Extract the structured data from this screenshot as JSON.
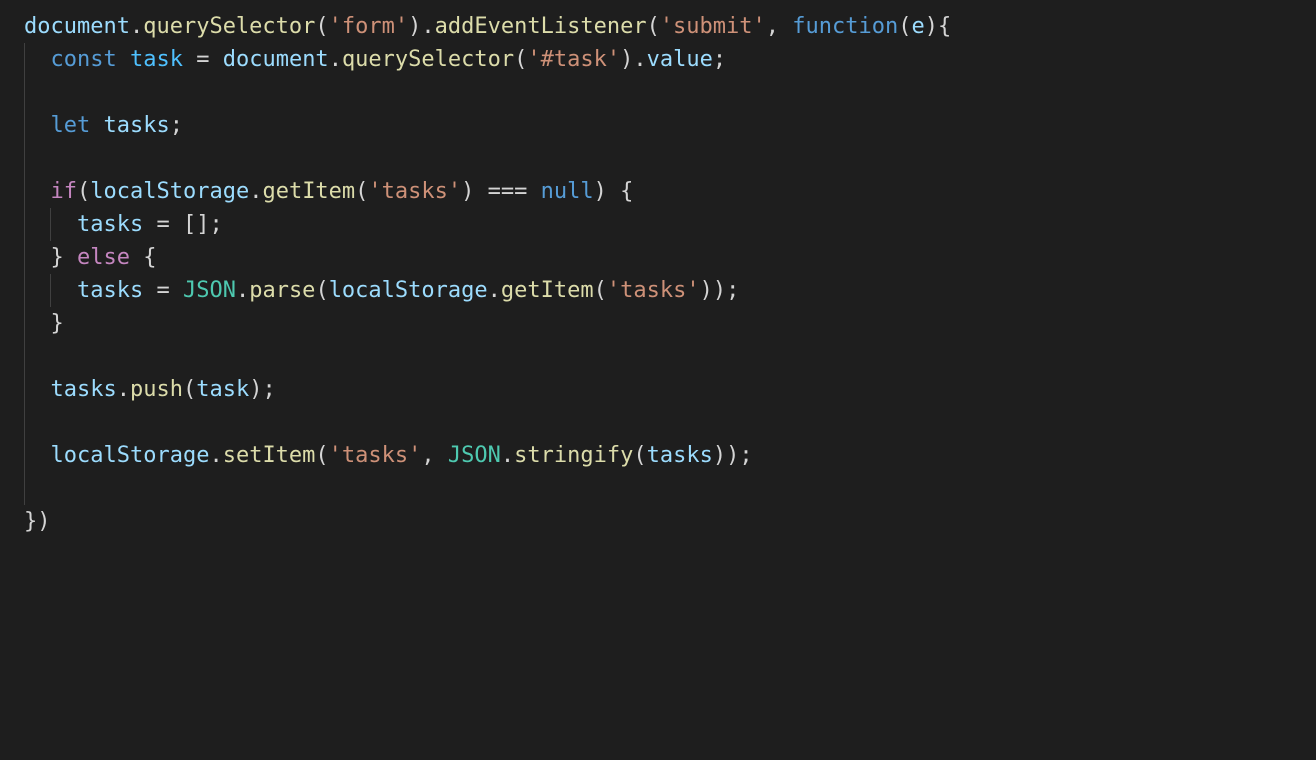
{
  "code": {
    "lines": [
      {
        "indent": 0,
        "tokens": [
          [
            "obj",
            "document"
          ],
          [
            "punc",
            "."
          ],
          [
            "meth",
            "querySelector"
          ],
          [
            "punc",
            "("
          ],
          [
            "str",
            "'form'"
          ],
          [
            "punc",
            ")."
          ],
          [
            "meth",
            "addEventListener"
          ],
          [
            "punc",
            "("
          ],
          [
            "str",
            "'submit'"
          ],
          [
            "punc",
            ", "
          ],
          [
            "kw",
            "function"
          ],
          [
            "punc",
            "("
          ],
          [
            "obj",
            "e"
          ],
          [
            "punc",
            "){"
          ]
        ]
      },
      {
        "indent": 1,
        "tokens": [
          [
            "kw",
            "const"
          ],
          [
            "punc",
            " "
          ],
          [
            "const",
            "task"
          ],
          [
            "punc",
            " = "
          ],
          [
            "obj",
            "document"
          ],
          [
            "punc",
            "."
          ],
          [
            "meth",
            "querySelector"
          ],
          [
            "punc",
            "("
          ],
          [
            "str",
            "'#task'"
          ],
          [
            "punc",
            ")."
          ],
          [
            "obj",
            "value"
          ],
          [
            "punc",
            ";"
          ]
        ]
      },
      {
        "indent": 1,
        "tokens": []
      },
      {
        "indent": 1,
        "tokens": [
          [
            "kw",
            "let"
          ],
          [
            "punc",
            " "
          ],
          [
            "obj",
            "tasks"
          ],
          [
            "punc",
            ";"
          ]
        ]
      },
      {
        "indent": 1,
        "tokens": []
      },
      {
        "indent": 1,
        "tokens": [
          [
            "ctrl",
            "if"
          ],
          [
            "punc",
            "("
          ],
          [
            "obj",
            "localStorage"
          ],
          [
            "punc",
            "."
          ],
          [
            "meth",
            "getItem"
          ],
          [
            "punc",
            "("
          ],
          [
            "str",
            "'tasks'"
          ],
          [
            "punc",
            ") === "
          ],
          [
            "kw",
            "null"
          ],
          [
            "punc",
            ") {"
          ]
        ]
      },
      {
        "indent": 2,
        "tokens": [
          [
            "obj",
            "tasks"
          ],
          [
            "punc",
            " = [];"
          ]
        ]
      },
      {
        "indent": 1,
        "tokens": [
          [
            "punc",
            "} "
          ],
          [
            "ctrl",
            "else"
          ],
          [
            "punc",
            " {"
          ]
        ]
      },
      {
        "indent": 2,
        "tokens": [
          [
            "obj",
            "tasks"
          ],
          [
            "punc",
            " = "
          ],
          [
            "type",
            "JSON"
          ],
          [
            "punc",
            "."
          ],
          [
            "meth",
            "parse"
          ],
          [
            "punc",
            "("
          ],
          [
            "obj",
            "localStorage"
          ],
          [
            "punc",
            "."
          ],
          [
            "meth",
            "getItem"
          ],
          [
            "punc",
            "("
          ],
          [
            "str",
            "'tasks'"
          ],
          [
            "punc",
            "));"
          ]
        ]
      },
      {
        "indent": 1,
        "tokens": [
          [
            "punc",
            "}"
          ]
        ]
      },
      {
        "indent": 1,
        "tokens": []
      },
      {
        "indent": 1,
        "tokens": [
          [
            "obj",
            "tasks"
          ],
          [
            "punc",
            "."
          ],
          [
            "meth",
            "push"
          ],
          [
            "punc",
            "("
          ],
          [
            "obj",
            "task"
          ],
          [
            "punc",
            ");"
          ]
        ]
      },
      {
        "indent": 1,
        "tokens": []
      },
      {
        "indent": 1,
        "tokens": [
          [
            "obj",
            "localStorage"
          ],
          [
            "punc",
            "."
          ],
          [
            "meth",
            "setItem"
          ],
          [
            "punc",
            "("
          ],
          [
            "str",
            "'tasks'"
          ],
          [
            "punc",
            ", "
          ],
          [
            "type",
            "JSON"
          ],
          [
            "punc",
            "."
          ],
          [
            "meth",
            "stringify"
          ],
          [
            "punc",
            "("
          ],
          [
            "obj",
            "tasks"
          ],
          [
            "punc",
            "));"
          ]
        ]
      },
      {
        "indent": 1,
        "tokens": []
      },
      {
        "indent": 0,
        "tokens": [
          [
            "punc",
            "})"
          ]
        ]
      }
    ]
  }
}
